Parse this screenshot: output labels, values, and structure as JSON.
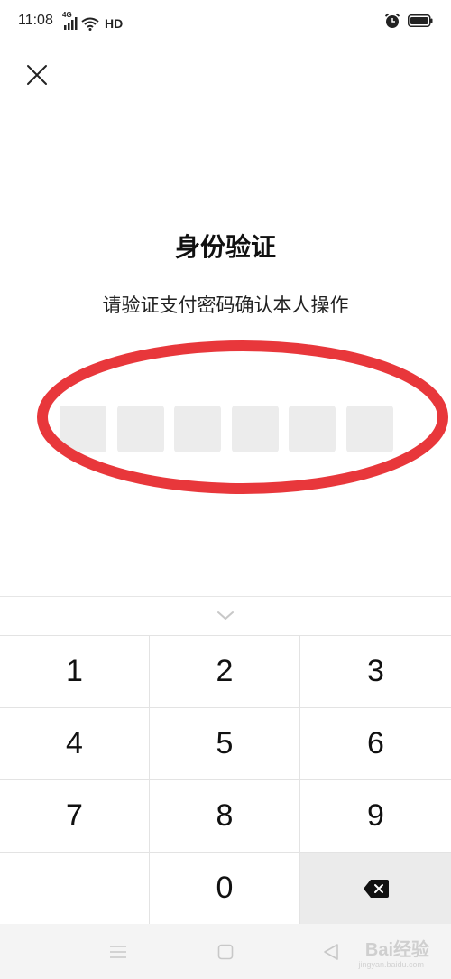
{
  "status_bar": {
    "time": "11:08",
    "network": "4G",
    "hd": "HD",
    "icons": [
      "signal-icon",
      "wifi-icon",
      "alarm-icon",
      "battery-icon"
    ]
  },
  "header": {
    "close_icon": "close-icon"
  },
  "verification": {
    "title": "身份验证",
    "subtitle": "请验证支付密码确认本人操作",
    "pin_length": 6,
    "pin_filled": 0
  },
  "annotation": {
    "shape": "ellipse",
    "color": "#e8373b"
  },
  "keyboard": {
    "collapse_icon": "chevron-down-icon",
    "keys": [
      "1",
      "2",
      "3",
      "4",
      "5",
      "6",
      "7",
      "8",
      "9",
      "",
      "0",
      "delete"
    ]
  },
  "nav_bar": {
    "buttons": [
      "menu-icon",
      "home-icon",
      "back-icon"
    ],
    "watermark": "Bai经验",
    "watermark_sub": "jingyan.baidu.com"
  }
}
